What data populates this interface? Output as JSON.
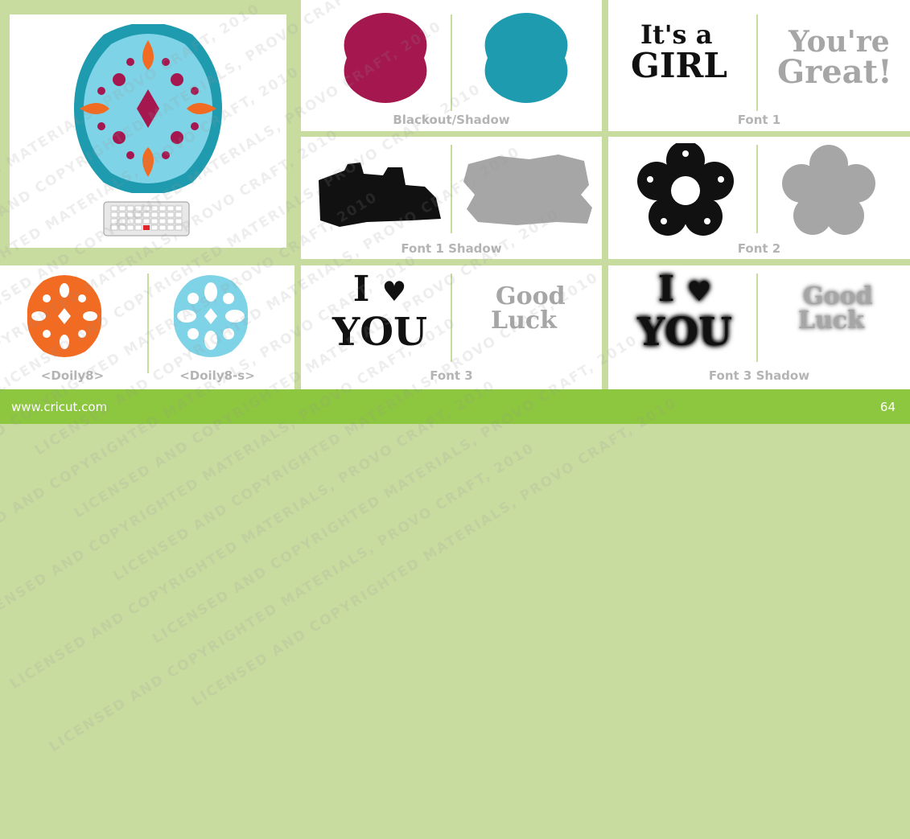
{
  "panels": {
    "preview": {
      "keypad": "keypad"
    },
    "blackout_shadow": {
      "label": "Blackout/Shadow"
    },
    "font1": {
      "label": "Font 1",
      "line1": "It's a",
      "line2": "GIRL",
      "line3": "You're",
      "line4": "Great!"
    },
    "font1_shadow": {
      "label": "Font 1 Shadow"
    },
    "font2": {
      "label": "Font 2"
    },
    "doily": {
      "label1": "<Doily8>",
      "label2": "<Doily8-s>"
    },
    "font3": {
      "label": "Font 3",
      "line1": "I",
      "line2": "YOU",
      "line3": "Good",
      "line4": "Luck"
    },
    "font3_shadow": {
      "label": "Font 3 Shadow",
      "line1": "I",
      "line2": "YOU",
      "line3": "Good",
      "line4": "Luck"
    }
  },
  "footer": {
    "url": "www.cricut.com",
    "page": "64"
  },
  "watermark": "LICENSED AND COPYRIGHTED MATERIALS, PROVO CRAFT, 2010",
  "colors": {
    "background": "#c9dca0",
    "footer": "#8dc63f",
    "magenta": "#a4174f",
    "teal": "#1f9bb0",
    "light_blue": "#7fd3e6",
    "orange": "#f26b22",
    "gray": "#a6a6a6",
    "black": "#111111"
  }
}
